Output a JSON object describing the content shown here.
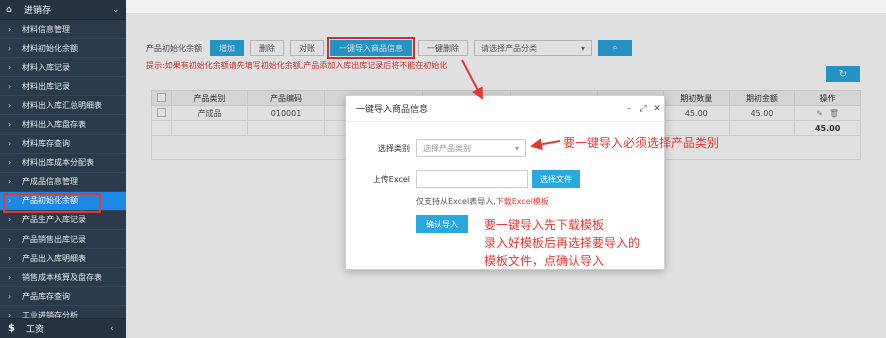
{
  "sidebar": {
    "header_label": "进销存",
    "items": [
      {
        "label": "材料信息管理"
      },
      {
        "label": "材料初始化余额"
      },
      {
        "label": "材料入库记录"
      },
      {
        "label": "材料出库记录"
      },
      {
        "label": "材料出入库汇总明细表"
      },
      {
        "label": "材料出入库盘存表"
      },
      {
        "label": "材料库存查询"
      },
      {
        "label": "材料出库成本分配表"
      },
      {
        "label": "产成品信息管理"
      },
      {
        "label": "产品初始化余额"
      },
      {
        "label": "产品生产入库记录"
      },
      {
        "label": "产品销售出库记录"
      },
      {
        "label": "产品出入库明细表"
      },
      {
        "label": "销售成本核算及盘存表"
      },
      {
        "label": "产品库存查询"
      },
      {
        "label": "工业进销存分析"
      }
    ],
    "footer_label": "工资",
    "footer_icon": "$"
  },
  "toolbar": {
    "label": "产品初始化余额",
    "add": "增加",
    "delete": "删除",
    "compare": "对账",
    "import": "一键导入商品信息",
    "batch_delete": "一键删除",
    "category_placeholder": "请选择产品分类"
  },
  "hint": "提示:如果有初始化余额请先填写初始化余额,产品添加入库出库记录后将不能在初始化",
  "table": {
    "headers": [
      "",
      "产品类别",
      "产品编码",
      "",
      "",
      "",
      "",
      "期初数量",
      "期初金额",
      "操作"
    ],
    "rows": [
      [
        "",
        "产成品",
        "010001",
        "",
        "",
        "",
        "",
        "45.00",
        "45.00",
        ""
      ]
    ],
    "total": "45.00"
  },
  "modal": {
    "title": "一键导入商品信息",
    "category_label": "选择类别",
    "category_placeholder": "选择产品类别",
    "upload_label": "上传Excel",
    "upload_button": "选择文件",
    "note_prefix": "仅支持从Excel表导入,",
    "note_link": "下载Excel模板",
    "confirm": "确认导入"
  },
  "annotations": {
    "a1": "要一键导入必须选择产品类别",
    "a2_lines": [
      "要一键导入先下载模板",
      "录入好模板后再选择要导入的",
      "模板文件，点确认导入"
    ]
  },
  "colors": {
    "accent": "#29a8e0",
    "annotation": "#e53935",
    "sidebar": "#2b3a4a"
  }
}
